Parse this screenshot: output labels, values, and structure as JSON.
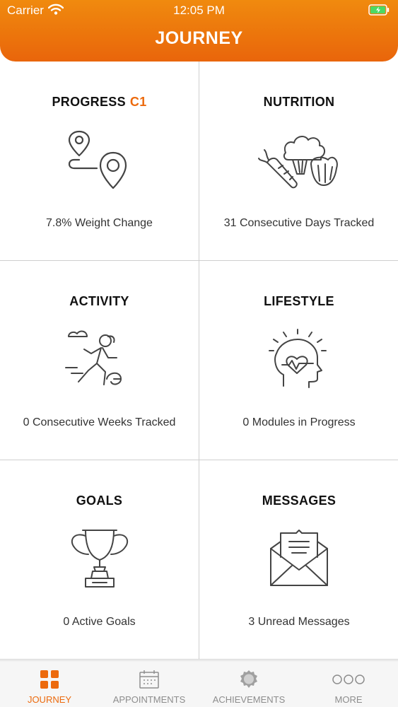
{
  "status_bar": {
    "carrier": "Carrier",
    "time": "12:05 PM"
  },
  "header": {
    "title": "JOURNEY"
  },
  "tiles": [
    {
      "title": "PROGRESS",
      "badge": "C1",
      "subtitle": "7.8% Weight Change",
      "icon": "route-map-icon"
    },
    {
      "title": "NUTRITION",
      "badge": "",
      "subtitle": "31 Consecutive Days Tracked",
      "icon": "vegetables-icon"
    },
    {
      "title": "ACTIVITY",
      "badge": "",
      "subtitle": "0 Consecutive Weeks Tracked",
      "icon": "runner-icon"
    },
    {
      "title": "LIFESTYLE",
      "badge": "",
      "subtitle": "0 Modules in Progress",
      "icon": "mind-heart-icon"
    },
    {
      "title": "GOALS",
      "badge": "",
      "subtitle": "0 Active Goals",
      "icon": "trophy-icon"
    },
    {
      "title": "MESSAGES",
      "badge": "",
      "subtitle": "3 Unread Messages",
      "icon": "envelope-icon"
    }
  ],
  "tabbar": {
    "items": [
      {
        "label": "JOURNEY",
        "icon": "grid-icon",
        "active": true
      },
      {
        "label": "APPOINTMENTS",
        "icon": "calendar-icon",
        "active": false
      },
      {
        "label": "ACHIEVEMENTS",
        "icon": "badge-icon",
        "active": false
      },
      {
        "label": "MORE",
        "icon": "more-icon",
        "active": false
      }
    ]
  },
  "colors": {
    "accent": "#ec6a0d",
    "header_top": "#f08a0e",
    "header_bottom": "#e9650b",
    "icon_stroke": "#444444"
  }
}
